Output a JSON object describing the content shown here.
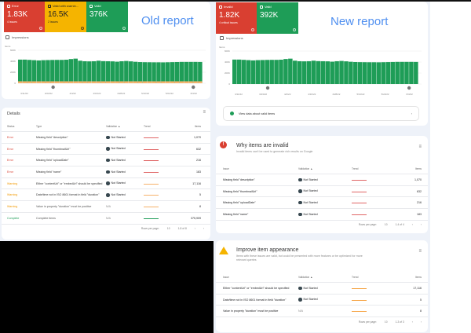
{
  "old": {
    "title": "Old report",
    "stats": [
      {
        "label": "Error",
        "value": "1.83K",
        "sub": "4 issues",
        "color": "#d93f31"
      },
      {
        "label": "Valid with warnin...",
        "value": "16.5K",
        "sub": "2 issues",
        "color": "#f5b400",
        "text": "#202124"
      },
      {
        "label": "Valid",
        "value": "376K",
        "sub": "",
        "color": "#1e9d57"
      }
    ],
    "impressions": "Impressions",
    "details_title": "Details",
    "headers": [
      "Status",
      "Type",
      "Validation ▲",
      "Trend",
      "Items"
    ],
    "rows": [
      [
        "Error",
        "Missing field \"description\"",
        "Not Started",
        "1,070",
        "#d93f31"
      ],
      [
        "Error",
        "Missing field \"thumbnailUrl\"",
        "Not Started",
        "632",
        "#d93f31"
      ],
      [
        "Error",
        "Missing field \"uploadDate\"",
        "Not Started",
        "216",
        "#d93f31"
      ],
      [
        "Error",
        "Missing field \"name\"",
        "Not Started",
        "183",
        "#d93f31"
      ],
      [
        "Warning",
        "Either \"contentUrl\" or \"embedUrl\" should be specified",
        "Not Started",
        "17,116",
        "#f29900"
      ],
      [
        "Warning",
        "Date/time not in ISO 8601 format in field \"duration\"",
        "Not Started",
        "5",
        "#f29900"
      ],
      [
        "Warning",
        "Value in property \"duration\" must be positive",
        "N/A",
        "8",
        "#f29900"
      ],
      [
        "Complete",
        "Complete items",
        "N/A",
        "375,909",
        "#1e9d57"
      ]
    ],
    "rows_per_page": "Rows per page:",
    "page_size": "10",
    "range": "1-8 of 8"
  },
  "new": {
    "title": "New report",
    "stats": [
      {
        "label": "Invalid",
        "value": "1.82K",
        "sub": "4 critical issues",
        "color": "#d93f31"
      },
      {
        "label": "Valid",
        "value": "392K",
        "sub": "",
        "color": "#1e9d57"
      }
    ],
    "impressions": "Impressions",
    "view_valid": "View data about valid items",
    "invalid": {
      "title": "Why items are invalid",
      "subtitle": "Invalid items can't be used to generate rich results on Google",
      "headers": [
        "Issue",
        "Validation ▲",
        "Trend",
        "Items"
      ],
      "rows": [
        [
          "Missing field \"description\"",
          "Not Started",
          "1,070"
        ],
        [
          "Missing field \"thumbnailUrl\"",
          "Not Started",
          "632"
        ],
        [
          "Missing field \"uploadDate\"",
          "Not Started",
          "216"
        ],
        [
          "Missing field \"name\"",
          "Not Started",
          "183"
        ]
      ],
      "rows_per_page": "Rows per page:",
      "page_size": "10",
      "range": "1-4 of 4",
      "trend_color": "#e06666"
    },
    "improve": {
      "title": "Improve item appearance",
      "subtitle": "Items with these issues are valid, but could be presented with more features or be optimized for more relevant queries",
      "headers": [
        "Issue",
        "Validation ▲",
        "Trend",
        "Items"
      ],
      "rows": [
        [
          "Either \"contentUrl\" or \"embedUrl\" should be specified",
          "Not Started",
          "17,116"
        ],
        [
          "Date/time not in ISO 8601 format in field \"duration\"",
          "Not Started",
          "5"
        ],
        [
          "Value in property \"duration\" must be positive",
          "N/A",
          "8"
        ]
      ],
      "rows_per_page": "Rows per page:",
      "page_size": "10",
      "range": "1-3 of 3",
      "trend_color": "#f6a341"
    }
  },
  "chart_data": [
    {
      "type": "bar",
      "ylabel": "Items",
      "ylim": [
        0,
        600000
      ],
      "yticks": [
        "600K",
        "400K",
        "200K",
        "0"
      ],
      "xticks": [
        "3/11/22",
        "3/23/22",
        "4/4/22",
        "4/16/22",
        "4/28/22",
        "5/10/22",
        "5/22/22",
        "6/3/22"
      ],
      "series": [
        {
          "color": "#1e9d57",
          "values": [
            430000,
            430000,
            425000,
            420000,
            415000,
            420000,
            422000,
            424000,
            425000,
            425000,
            428000,
            440000,
            448000,
            410000,
            400000,
            398000,
            400000,
            410000,
            402000,
            400000,
            398000,
            392000,
            400000,
            405000,
            398000,
            390000,
            385000,
            383000,
            382000,
            381000,
            381000,
            380000,
            382000,
            384000,
            386000,
            388000,
            388000,
            388000,
            388000,
            387000
          ]
        },
        {
          "color": "#f6b26b",
          "values": [
            17000,
            17000,
            17000,
            17000,
            17000,
            17000,
            17000,
            17000,
            17000,
            17000,
            17000,
            17000,
            17000,
            17000,
            17000,
            17000,
            17000,
            17000,
            17000,
            17000,
            17000,
            17000,
            17000,
            17000,
            17000,
            17000,
            17000,
            17000,
            17000,
            17000,
            17000,
            17000,
            17000,
            17000,
            17000,
            17000,
            17000,
            17000,
            17000,
            17000
          ]
        }
      ]
    },
    {
      "type": "bar",
      "ylabel": "Items",
      "ylim": [
        0,
        600000
      ],
      "yticks": [
        "600K",
        "400K",
        "200K",
        "0"
      ],
      "xticks": [
        "3/11/22",
        "3/23/22",
        "4/4/22",
        "4/16/22",
        "4/28/22",
        "5/10/22",
        "5/22/22",
        "6/3/22"
      ],
      "series": [
        {
          "color": "#1e9d57",
          "values": [
            445000,
            445000,
            440000,
            435000,
            430000,
            435000,
            437000,
            439000,
            440000,
            440000,
            443000,
            455000,
            462000,
            425000,
            415000,
            413000,
            415000,
            425000,
            417000,
            415000,
            413000,
            407000,
            415000,
            420000,
            413000,
            405000,
            400000,
            398000,
            397000,
            396000,
            396000,
            395000,
            397000,
            399000,
            401000,
            403000,
            403000,
            403000,
            403000,
            402000
          ]
        }
      ]
    }
  ]
}
